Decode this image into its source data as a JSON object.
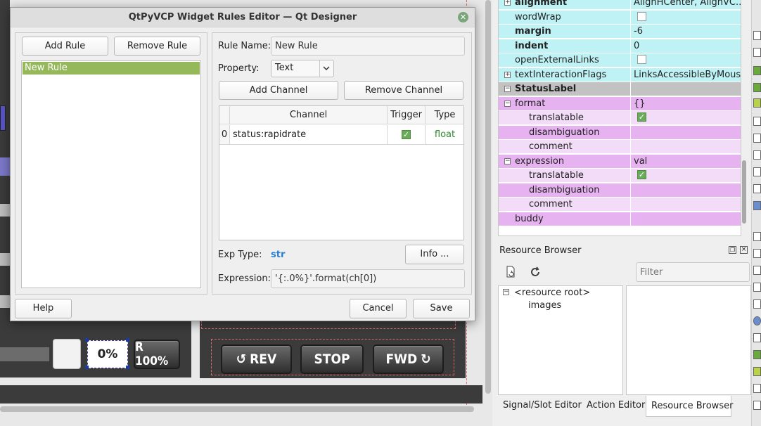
{
  "dialog": {
    "title": "QtPyVCP Widget Rules Editor — Qt Designer",
    "add_rule": "Add Rule",
    "remove_rule": "Remove Rule",
    "rules": [
      "New Rule"
    ],
    "rule_name_label": "Rule Name:",
    "rule_name_value": "New Rule",
    "property_label": "Property:",
    "property_value": "Text",
    "add_channel": "Add Channel",
    "remove_channel": "Remove Channel",
    "table": {
      "headers": [
        "Channel",
        "Trigger",
        "Type"
      ],
      "rows": [
        {
          "index": "0",
          "channel": "status:rapidrate",
          "trigger": true,
          "type": "float"
        }
      ]
    },
    "exp_type_label": "Exp Type:",
    "exp_type_value": "str",
    "info_button": "Info ...",
    "expression_label": "Expression:",
    "expression_value": "'{:.0%}'.format(ch[0])",
    "help": "Help",
    "cancel": "Cancel",
    "save": "Save"
  },
  "background": {
    "percent_label": "0%",
    "rapid_button": "R 100%",
    "rev_button": "REV",
    "stop_button": "STOP",
    "fwd_button": "FWD"
  },
  "property_editor": {
    "rows": [
      {
        "name": "alignment",
        "value": "AlignHCenter, AlignVC...",
        "bold": true,
        "toggle": "+",
        "indent": 0,
        "color": "cyan"
      },
      {
        "name": "wordWrap",
        "value": "",
        "checkbox": false,
        "indent": 0,
        "color": "cyan"
      },
      {
        "name": "margin",
        "value": "-6",
        "bold": true,
        "indent": 0,
        "color": "cyan"
      },
      {
        "name": "indent",
        "value": "0",
        "bold": true,
        "indent": 0,
        "color": "cyan"
      },
      {
        "name": "openExternalLinks",
        "value": "",
        "checkbox": false,
        "indent": 0,
        "color": "cyan"
      },
      {
        "name": "textInteractionFlags",
        "value": "LinksAccessibleByMouse",
        "toggle": "+",
        "indent": 0,
        "color": "cyan"
      },
      {
        "name": "StatusLabel",
        "value": "",
        "bold": true,
        "toggle": "−",
        "indent": 0,
        "color": "grey",
        "group": true
      },
      {
        "name": "format",
        "value": "{}",
        "toggle": "−",
        "indent": 0,
        "color": "pink"
      },
      {
        "name": "translatable",
        "value": "",
        "checkbox": true,
        "indent": 1,
        "color": "pinklight"
      },
      {
        "name": "disambiguation",
        "value": "",
        "indent": 1,
        "color": "pink"
      },
      {
        "name": "comment",
        "value": "",
        "indent": 1,
        "color": "pinklight"
      },
      {
        "name": "expression",
        "value": "val",
        "toggle": "−",
        "indent": 0,
        "color": "pink"
      },
      {
        "name": "translatable",
        "value": "",
        "checkbox": true,
        "indent": 1,
        "color": "pinklight"
      },
      {
        "name": "disambiguation",
        "value": "",
        "indent": 1,
        "color": "pink"
      },
      {
        "name": "comment",
        "value": "",
        "indent": 1,
        "color": "pinklight"
      },
      {
        "name": "buddy",
        "value": "",
        "indent": 0,
        "color": "pink"
      }
    ]
  },
  "resource_browser": {
    "title": "Resource Browser",
    "filter_placeholder": "Filter",
    "tree": [
      "<resource root>",
      "images"
    ]
  },
  "bottom_tabs": [
    "Signal/Slot Editor",
    "Action Editor",
    "Resource Browser"
  ],
  "colors": {
    "accent_green": "#94b85a",
    "float_type": "#2e8b2e",
    "str_type": "#2a7fcf"
  }
}
